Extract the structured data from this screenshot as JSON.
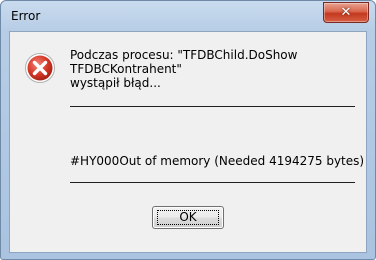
{
  "window": {
    "title": "Error"
  },
  "titlebar": {
    "close_glyph": "✕"
  },
  "icon": {
    "name": "error-icon",
    "color": "#c42b1c"
  },
  "message": {
    "line1": "Podczas procesu: \"TFDBChild.DoShow",
    "line2": "TFDBCKontrahent\"",
    "line3": "wystąpił błąd..."
  },
  "detail": "#HY000Out of memory (Needed 4194275 bytes)",
  "buttons": {
    "ok_label": "OK"
  }
}
